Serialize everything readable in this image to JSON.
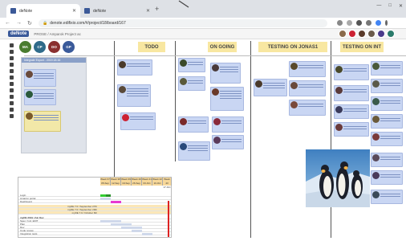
{
  "browser": {
    "tabs": [
      {
        "title": "deNote",
        "active": true
      },
      {
        "title": "deNote",
        "active": false
      }
    ],
    "url": "denote.edifixio.com/#/project/18/board/167",
    "window_controls": [
      "—",
      "□",
      "✕"
    ]
  },
  "app": {
    "logo": "deNote",
    "breadcrumb": "PROSE / Amparok Project ac"
  },
  "team": [
    {
      "initials": "MA",
      "color": "#4a7c2f"
    },
    {
      "initials": "CP",
      "color": "#2f6b8a"
    },
    {
      "initials": "DO",
      "color": "#8a2f2f"
    },
    {
      "initials": "GP",
      "color": "#3a5a9a"
    }
  ],
  "columns": [
    {
      "title": "TODO"
    },
    {
      "title": "ON GOING"
    },
    {
      "title": "TESTING ON JONAS1"
    },
    {
      "title": "TESTING ON INT"
    }
  ],
  "backlog": {
    "title": "Integrale Export - 2019.18.16"
  },
  "gantt": {
    "weeks": [
      {
        "label": "Week 37",
        "sub": "05-Sep"
      },
      {
        "label": "Week 38",
        "sub": "12-Sep"
      },
      {
        "label": "Week 39",
        "sub": "19-Sep"
      },
      {
        "label": "Week 40",
        "sub": "26-Sep"
      },
      {
        "label": "Week 41",
        "sub": "03-Oct"
      },
      {
        "label": "Week 42",
        "sub": "10-Oct"
      },
      {
        "label": "Week 43",
        "sub": "17-Oct"
      }
    ],
    "rows": [
      {
        "label": "Login",
        "hl": false
      },
      {
        "label": "Amazon portal",
        "hl": false
      },
      {
        "label": "Dashboard",
        "hl": false
      },
      {
        "label": "myDE 7.0 / September 27th",
        "hl": true
      },
      {
        "label": "myDE 7.0 / September 29th",
        "hl": true
      },
      {
        "label": "myDE 7.0 / October 6th",
        "hl": true
      },
      {
        "label": "myDE 2019 / Ain Dev",
        "hl": false
      },
      {
        "label": "Spec / Incl. EDIT",
        "hl": false
      },
      {
        "label": "Plan",
        "hl": false
      },
      {
        "label": "Dev",
        "hl": false
      },
      {
        "label": "Code review",
        "hl": false
      },
      {
        "label": "Integration tests",
        "hl": false
      }
    ]
  }
}
